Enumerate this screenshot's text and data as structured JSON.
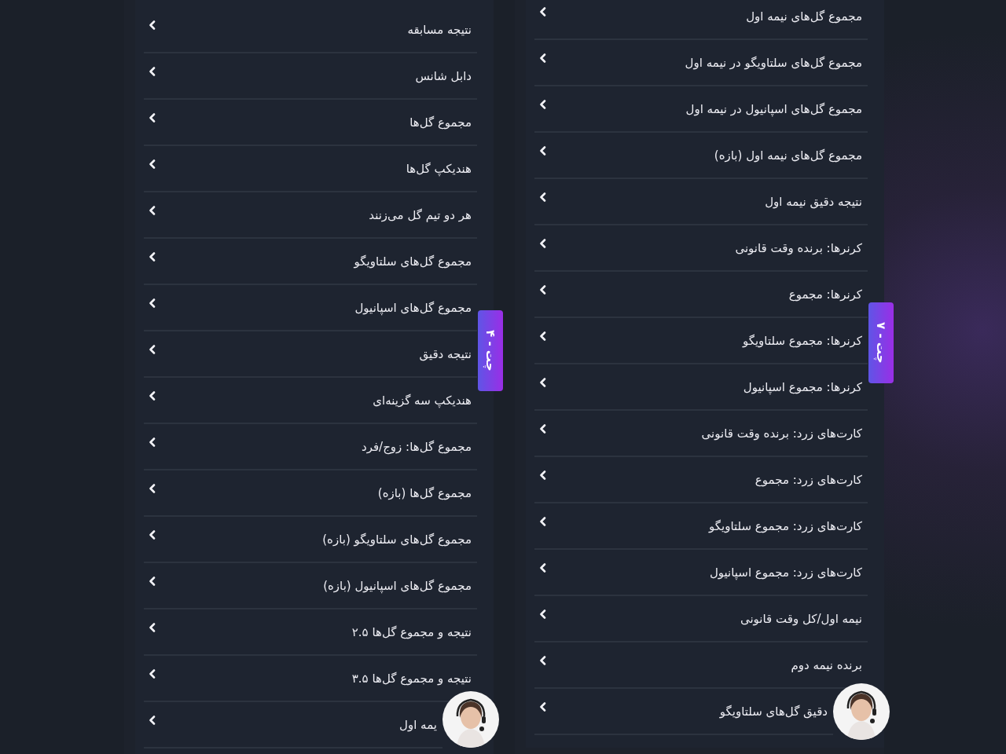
{
  "panels": [
    {
      "chat_tab": "چت - ۴",
      "items": [
        "نتیجه مسابقه",
        "دابل شانس",
        "مجموع گل‌ها",
        "هندیکپ گل‌ها",
        "هر دو تیم گل می‌زنند",
        "مجموع گل‌های سلتاویگو",
        "مجموع گل‌های اسپانیول",
        "نتیجه دقیق",
        "هندیکپ سه گزینه‌ای",
        "مجموع گل‌ها: زوج/فرد",
        "مجموع گل‌ها (بازه)",
        "مجموع گل‌های سلتاویگو (بازه)",
        "مجموع گل‌های اسپانیول (بازه)",
        "نتیجه و مجموع گل‌ها ۲.۵",
        "نتیجه و مجموع گل‌ها ۳.۵",
        "یمه اول"
      ]
    },
    {
      "chat_tab": "چت - ۷",
      "items": [
        "مجموع گل‌های نیمه اول",
        "مجموع گل‌های سلتاویگو در نیمه اول",
        "مجموع گل‌های اسپانیول در نیمه اول",
        "مجموع گل‌های نیمه اول (بازه)",
        "نتیجه دقیق نیمه اول",
        "کرنرها: برنده وقت قانونی",
        "کرنرها: مجموع",
        "کرنرها: مجموع سلتاویگو",
        "کرنرها: مجموع اسپانیول",
        "کارت‌های زرد: برنده وقت قانونی",
        "کارت‌های زرد: مجموع",
        "کارت‌های زرد: مجموع سلتاویگو",
        "کارت‌های زرد: مجموع اسپانیول",
        "نیمه اول/کل وقت قانونی",
        "برنده نیمه دوم",
        "دقیق گل‌های سلتاویگو"
      ]
    }
  ]
}
